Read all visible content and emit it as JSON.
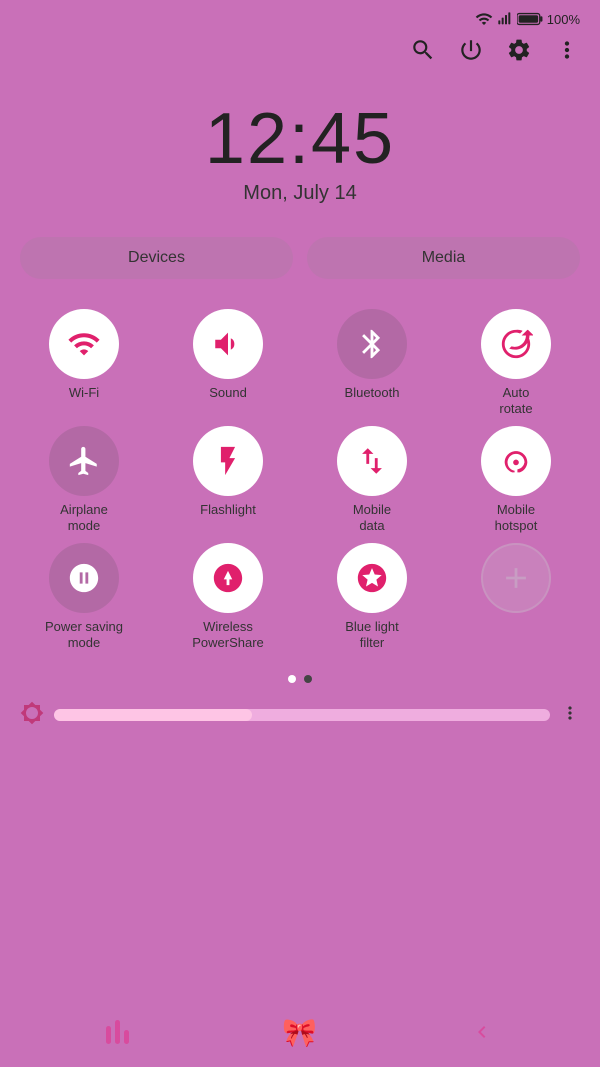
{
  "statusBar": {
    "wifi": "wifi-icon",
    "signal": "signal-icon",
    "battery": "100%"
  },
  "topActions": {
    "search": "search-icon",
    "power": "power-icon",
    "settings": "settings-icon",
    "more": "more-icon"
  },
  "clock": {
    "time": "12:45",
    "date": "Mon, July 14"
  },
  "tabs": {
    "devices": "Devices",
    "media": "Media"
  },
  "quickToggles": [
    {
      "id": "wifi",
      "label": "Wi-Fi",
      "active": true
    },
    {
      "id": "sound",
      "label": "Sound",
      "active": true
    },
    {
      "id": "bluetooth",
      "label": "Bluetooth",
      "active": false
    },
    {
      "id": "autorotate",
      "label": "Auto\nrotate",
      "active": true
    },
    {
      "id": "airplane",
      "label": "Airplane\nmode",
      "active": false
    },
    {
      "id": "flashlight",
      "label": "Flashlight",
      "active": true
    },
    {
      "id": "mobiledata",
      "label": "Mobile\ndata",
      "active": true
    },
    {
      "id": "mobilehotspot",
      "label": "Mobile\nhotspot",
      "active": true
    },
    {
      "id": "powersaving",
      "label": "Power saving\nmode",
      "active": false
    },
    {
      "id": "wirelesspowershare",
      "label": "Wireless\nPowerShare",
      "active": true
    },
    {
      "id": "bluelightfilter",
      "label": "Blue light\nfilter",
      "active": true
    },
    {
      "id": "add",
      "label": "",
      "active": false
    }
  ],
  "brightness": {
    "label": "Brightness"
  },
  "bottomNav": {
    "recents": "recents-icon",
    "home": "home-icon",
    "back": "back-icon"
  }
}
